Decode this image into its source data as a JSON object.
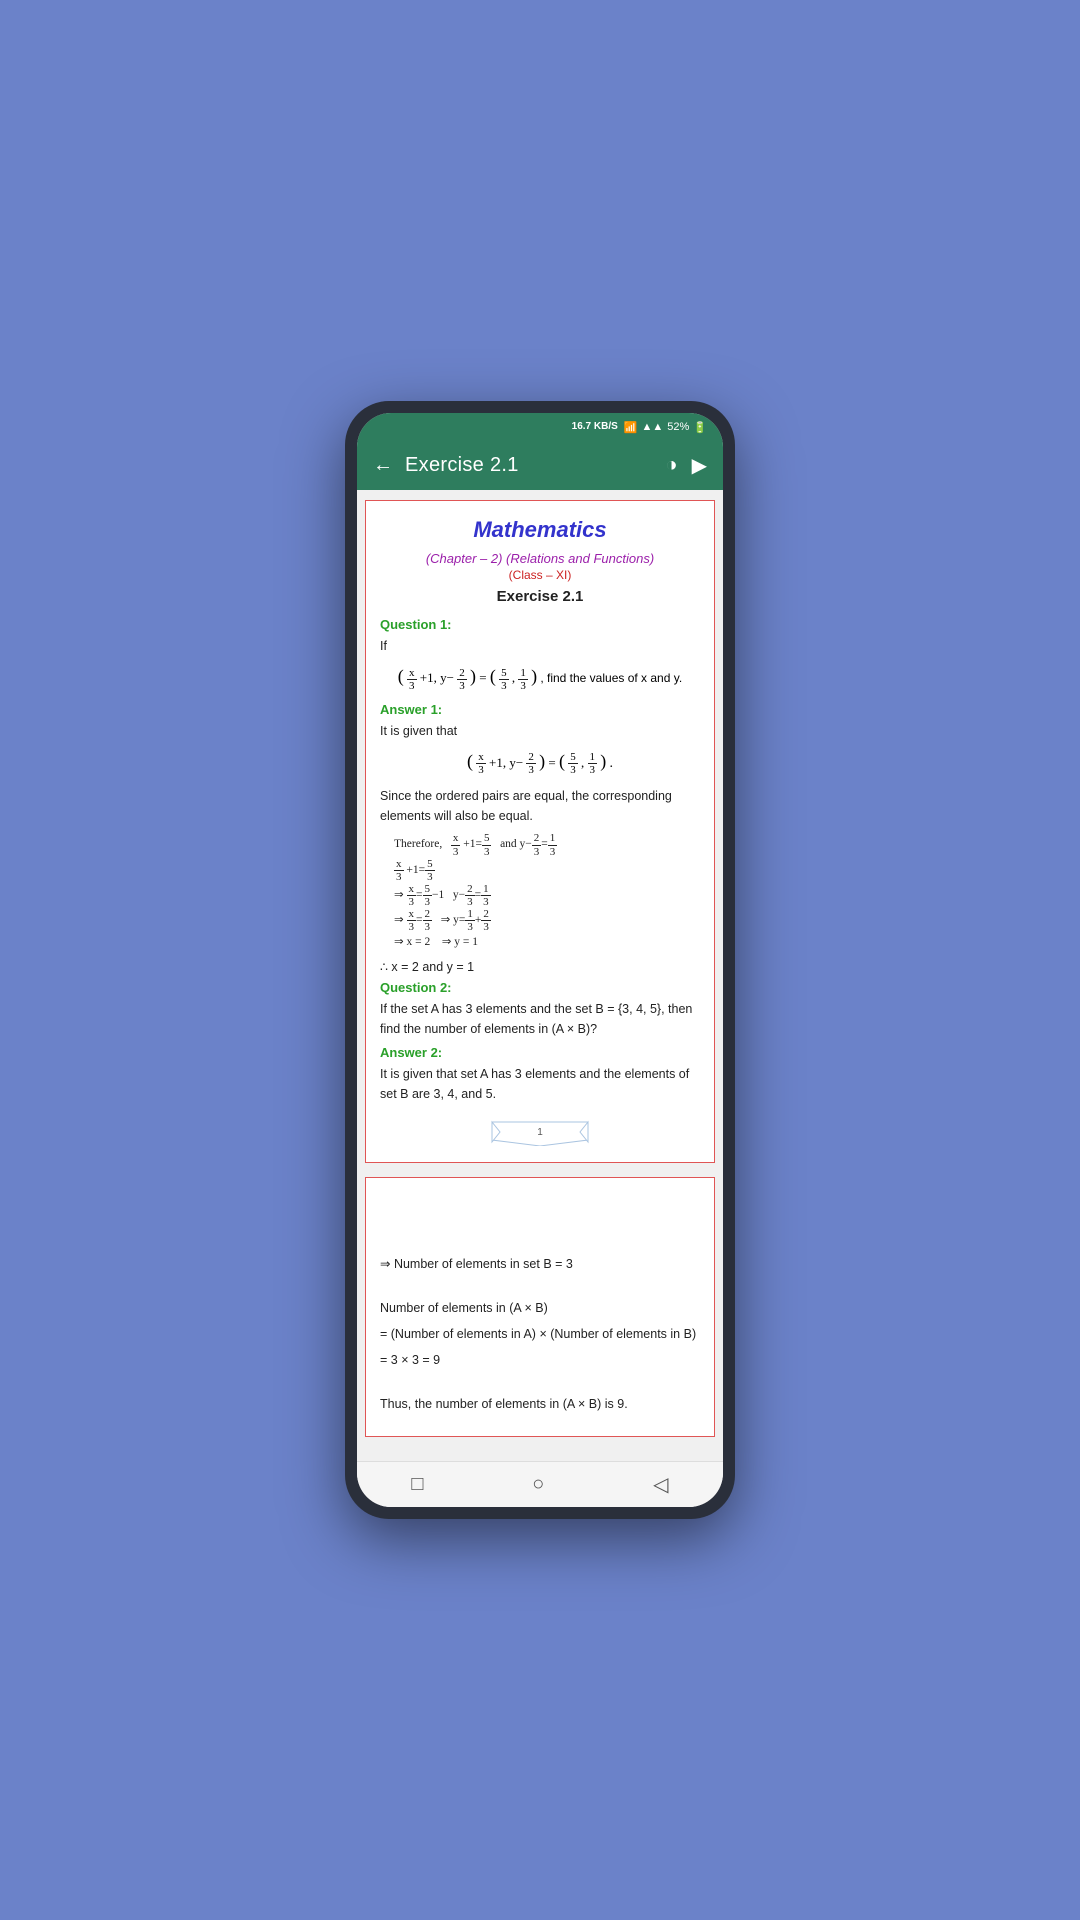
{
  "statusBar": {
    "speed": "16.7\nKB/S",
    "battery": "52%"
  },
  "toolbar": {
    "back_icon": "←",
    "title": "Exercise 2.1",
    "contrast_icon": "◑",
    "play_icon": "▶"
  },
  "page": {
    "number": "1",
    "title": "Mathematics",
    "chapter_subtitle": "(Chapter – 2) (Relations and Functions)",
    "class_subtitle": "(Class – XI)",
    "exercise_heading": "Exercise 2.1",
    "question1_label": "Question 1:",
    "question1_text": "If",
    "question1_find": ", find the values of x and y.",
    "answer1_label": "Answer 1:",
    "answer1_intro": "It is given that",
    "answer1_equal_text": "Since the ordered pairs are equal, the corresponding elements will also be equal.",
    "answer1_therefore": "Therefore,",
    "answer1_and": "and",
    "answer1_steps": [
      "x/3 + 1 = 5/3",
      "⇒ x/3 = 5/3 - 1  y - 2/3 = 1/3",
      "⇒ x/3 = 2/3  ⇒ y = 1/3 + 2/3",
      "⇒ x = 2  ⇒ y = 1"
    ],
    "answer1_conclusion": "∴ x = 2 and y = 1",
    "question2_label": "Question 2:",
    "question2_text": "If the set A has 3 elements and the set B = {3, 4, 5}, then find the number of elements in (A × B)?",
    "answer2_label": "Answer 2:",
    "answer2_text": "It is given that set A has 3 elements and the elements of set B are 3, 4, and 5.",
    "ribbon_label": "1"
  },
  "page2": {
    "line1": "⇒ Number of elements in set B = 3",
    "line2": "Number of elements in (A × B)",
    "line3": "= (Number of elements in A) × (Number of elements in B)",
    "line4": "= 3 × 3 = 9",
    "line5": "Thus, the number of elements in (A × B) is 9."
  },
  "bottomNav": {
    "square_icon": "□",
    "circle_icon": "○",
    "triangle_icon": "◁"
  }
}
